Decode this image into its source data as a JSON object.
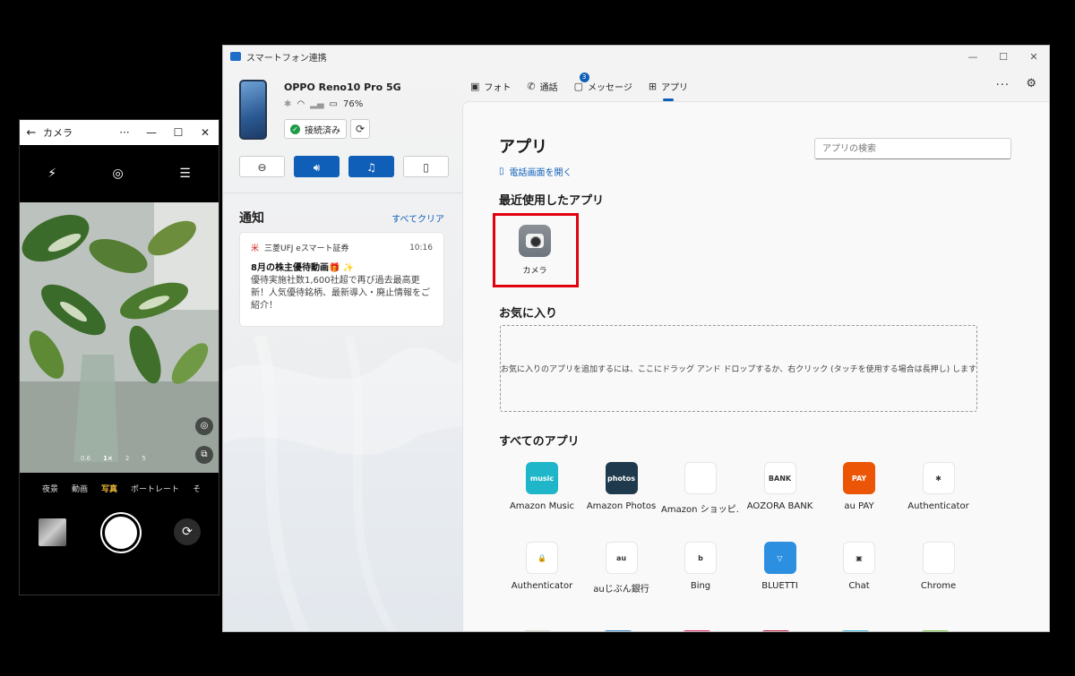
{
  "camera_window": {
    "title": "カメラ",
    "more": "···",
    "minimize": "—",
    "maximize": "☐",
    "close": "✕",
    "zoom_levels": [
      "0.6",
      "1×",
      "2",
      "5"
    ],
    "modes": [
      "夜景",
      "動画",
      "写真",
      "ポートレート",
      "そ"
    ],
    "selected_mode": "写真"
  },
  "phone_link": {
    "window_title": "スマートフォン連携",
    "device": {
      "name": "OPPO Reno10 Pro 5G",
      "battery": "76%",
      "status": "接続済み"
    },
    "notifications": {
      "heading": "通知",
      "clear_all": "すべてクリア",
      "items": [
        {
          "source": "三菱UFJ eスマート証券",
          "time": "10:16",
          "title": "8月の株主優待動画🎁 ✨",
          "body": "優待実施社数1,600社超で再び過去最高更新！人気優待銘柄、最新導入・廃止情報をご紹介！"
        }
      ]
    },
    "tabs": [
      {
        "label": "フォト",
        "icon": "photo-icon"
      },
      {
        "label": "通話",
        "icon": "phone-icon"
      },
      {
        "label": "メッセージ",
        "icon": "message-icon",
        "badge": "3"
      },
      {
        "label": "アプリ",
        "icon": "apps-icon",
        "active": true
      }
    ],
    "apps_page": {
      "title": "アプリ",
      "search_placeholder": "アプリの検索",
      "open_dialer": "電話画面を開く",
      "recent_heading": "最近使用したアプリ",
      "recent_apps": [
        {
          "name": "カメラ"
        }
      ],
      "favorites_heading": "お気に入り",
      "favorites_hint": "お気に入りのアプリを追加するには、ここにドラッグ アンド ドロップするか、右クリック (タッチを使用する場合は長押し) します",
      "all_heading": "すべてのアプリ",
      "all_apps": [
        {
          "name": "Amazon Music",
          "icon_text": "music",
          "color": "#1fb6c9"
        },
        {
          "name": "Amazon Photos",
          "icon_text": "photos",
          "color": "#1f3a4d"
        },
        {
          "name": "Amazon ショッピ…",
          "icon_text": "",
          "color": "#ffffff"
        },
        {
          "name": "AOZORA BANK",
          "icon_text": "BANK",
          "color": "#ffffff"
        },
        {
          "name": "au PAY",
          "icon_text": "PAY",
          "color": "#eb5505"
        },
        {
          "name": "Authenticator",
          "icon_text": "✱",
          "color": "#ffffff"
        },
        {
          "name": "Authenticator",
          "icon_text": "🔒",
          "color": "#ffffff"
        },
        {
          "name": "auじぶん銀行",
          "icon_text": "au",
          "color": "#ffffff"
        },
        {
          "name": "Bing",
          "icon_text": "b",
          "color": "#ffffff"
        },
        {
          "name": "BLUETTI",
          "icon_text": "▽",
          "color": "#2d8fe0"
        },
        {
          "name": "Chat",
          "icon_text": "▣",
          "color": "#ffffff"
        },
        {
          "name": "Chrome",
          "icon_text": "",
          "color": "#ffffff"
        }
      ]
    }
  }
}
